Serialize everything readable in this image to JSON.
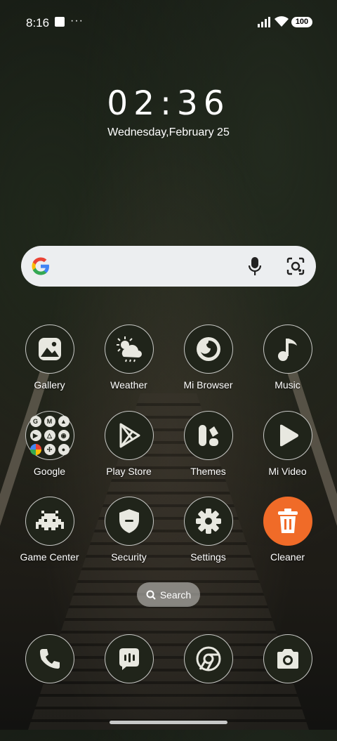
{
  "status_bar": {
    "time": "8:16",
    "dots": "···",
    "battery": "100"
  },
  "lock_clock": {
    "time": "02:36",
    "date": "Wednesday,February 25"
  },
  "search_bar": {
    "google_glyph": "G"
  },
  "apps": [
    {
      "label": "Gallery",
      "icon": "gallery-icon"
    },
    {
      "label": "Weather",
      "icon": "weather-icon"
    },
    {
      "label": "Mi Browser",
      "icon": "browser-icon"
    },
    {
      "label": "Music",
      "icon": "music-icon"
    },
    {
      "label": "Google",
      "icon": "google-folder-icon"
    },
    {
      "label": "Play Store",
      "icon": "play-store-icon"
    },
    {
      "label": "Themes",
      "icon": "themes-icon"
    },
    {
      "label": "Mi Video",
      "icon": "video-icon"
    },
    {
      "label": "Game Center",
      "icon": "game-icon"
    },
    {
      "label": "Security",
      "icon": "shield-icon"
    },
    {
      "label": "Settings",
      "icon": "gear-icon"
    },
    {
      "label": "Cleaner",
      "icon": "trash-icon"
    }
  ],
  "folder_minis": [
    "G",
    "M",
    "",
    "",
    "",
    "",
    "",
    "",
    ""
  ],
  "app_search": {
    "label": "Search"
  },
  "dock": [
    {
      "icon": "phone-icon"
    },
    {
      "icon": "messages-icon"
    },
    {
      "icon": "chrome-icon"
    },
    {
      "icon": "camera-icon"
    }
  ],
  "colors": {
    "icon_bg": "#20241a",
    "cleaner_accent": "#f06b28",
    "search_bg": "#eceef0"
  }
}
